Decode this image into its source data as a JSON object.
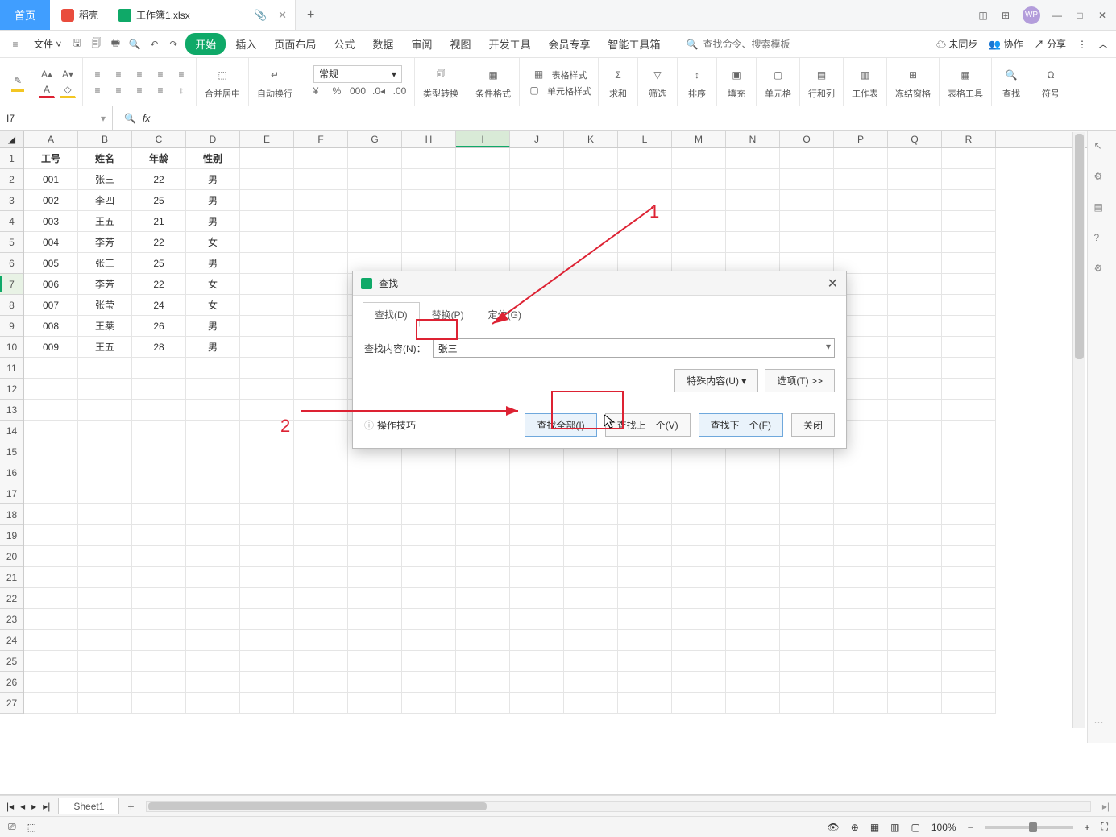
{
  "tabs": {
    "home": "首页",
    "shell": "稻壳",
    "file": "工作簿1.xlsx",
    "add": "+"
  },
  "win": {
    "wp": "WP"
  },
  "menubar": {
    "file": "文件",
    "items": [
      "开始",
      "插入",
      "页面布局",
      "公式",
      "数据",
      "审阅",
      "视图",
      "开发工具",
      "会员专享",
      "智能工具箱"
    ],
    "search_placeholder": "查找命令、搜索模板",
    "unsynced": "未同步",
    "collab": "协作",
    "share": "分享"
  },
  "ribbon": {
    "merge": "合并居中",
    "wrap": "自动换行",
    "format_combo": "常规",
    "currency": "¥",
    "percent": "%",
    "comma": "000",
    "inc": "←0",
    ".dec": ".00",
    "type_conv": "类型转换",
    "cond_fmt": "条件格式",
    "tbl_style": "表格样式",
    "cell_style": "单元格样式",
    "sum": "求和",
    "filter": "筛选",
    "sort": "排序",
    "fill": "填充",
    "cell": "单元格",
    "rowcol": "行和列",
    "sheet": "工作表",
    "freeze": "冻结窗格",
    "tools": "表格工具",
    "find": "查找",
    "symbol": "符号"
  },
  "namebox": {
    "ref": "I7",
    "fx": "fx"
  },
  "columns": [
    "A",
    "B",
    "C",
    "D",
    "E",
    "F",
    "G",
    "H",
    "I",
    "J",
    "K",
    "L",
    "M",
    "N",
    "O",
    "P",
    "Q",
    "R"
  ],
  "row_count": 27,
  "selected_cell": {
    "col": "I",
    "row": 7
  },
  "data_rows": [
    {
      "A": "工号",
      "B": "姓名",
      "C": "年龄",
      "D": "性别"
    },
    {
      "A": "001",
      "B": "张三",
      "C": "22",
      "D": "男"
    },
    {
      "A": "002",
      "B": "李四",
      "C": "25",
      "D": "男"
    },
    {
      "A": "003",
      "B": "王五",
      "C": "21",
      "D": "男"
    },
    {
      "A": "004",
      "B": "李芳",
      "C": "22",
      "D": "女"
    },
    {
      "A": "005",
      "B": "张三",
      "C": "25",
      "D": "男"
    },
    {
      "A": "006",
      "B": "李芳",
      "C": "22",
      "D": "女"
    },
    {
      "A": "007",
      "B": "张莹",
      "C": "24",
      "D": "女"
    },
    {
      "A": "008",
      "B": "王莱",
      "C": "26",
      "D": "男"
    },
    {
      "A": "009",
      "B": "王五",
      "C": "28",
      "D": "男"
    }
  ],
  "dialog": {
    "title": "查找",
    "tabs": {
      "find": "查找(D)",
      "replace": "替换(P)",
      "goto": "定位(G)"
    },
    "find_label": "查找内容(N)：",
    "find_value": "张三",
    "special": "特殊内容(U)",
    "options": "选项(T) >>",
    "tips": "操作技巧",
    "btn_all": "查找全部(I)",
    "btn_prev": "查找上一个(V)",
    "btn_next": "查找下一个(F)",
    "btn_close": "关闭"
  },
  "annotations": {
    "one": "1",
    "two": "2"
  },
  "sheettabs": {
    "sheet1": "Sheet1",
    "add": "+"
  },
  "statusbar": {
    "zoom": "100%",
    "minus": "−",
    "plus": "+"
  }
}
